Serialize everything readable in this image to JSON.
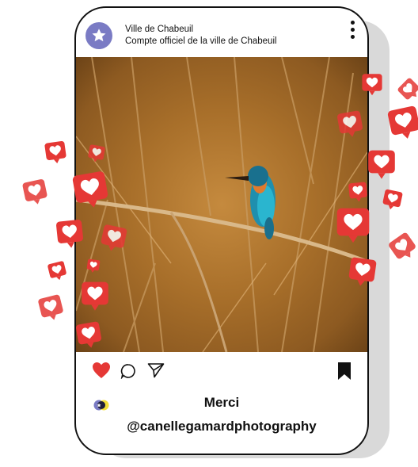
{
  "post": {
    "account_name": "Ville de Chabeuil",
    "account_description": "Compte officiel de la ville de Chabeuil",
    "caption_title": "Merci",
    "caption_handle": "@canellegamardphotography",
    "liked": true
  },
  "colors": {
    "heart_red": "#e53835",
    "bubble_red": "#e53835",
    "bubble_light": "#ef5b58",
    "avatar": "#7a7bc4",
    "outline": "#111111"
  },
  "icons": [
    "star-icon",
    "more-vertical-icon",
    "heart-icon",
    "comment-icon",
    "share-icon",
    "bookmark-icon"
  ]
}
